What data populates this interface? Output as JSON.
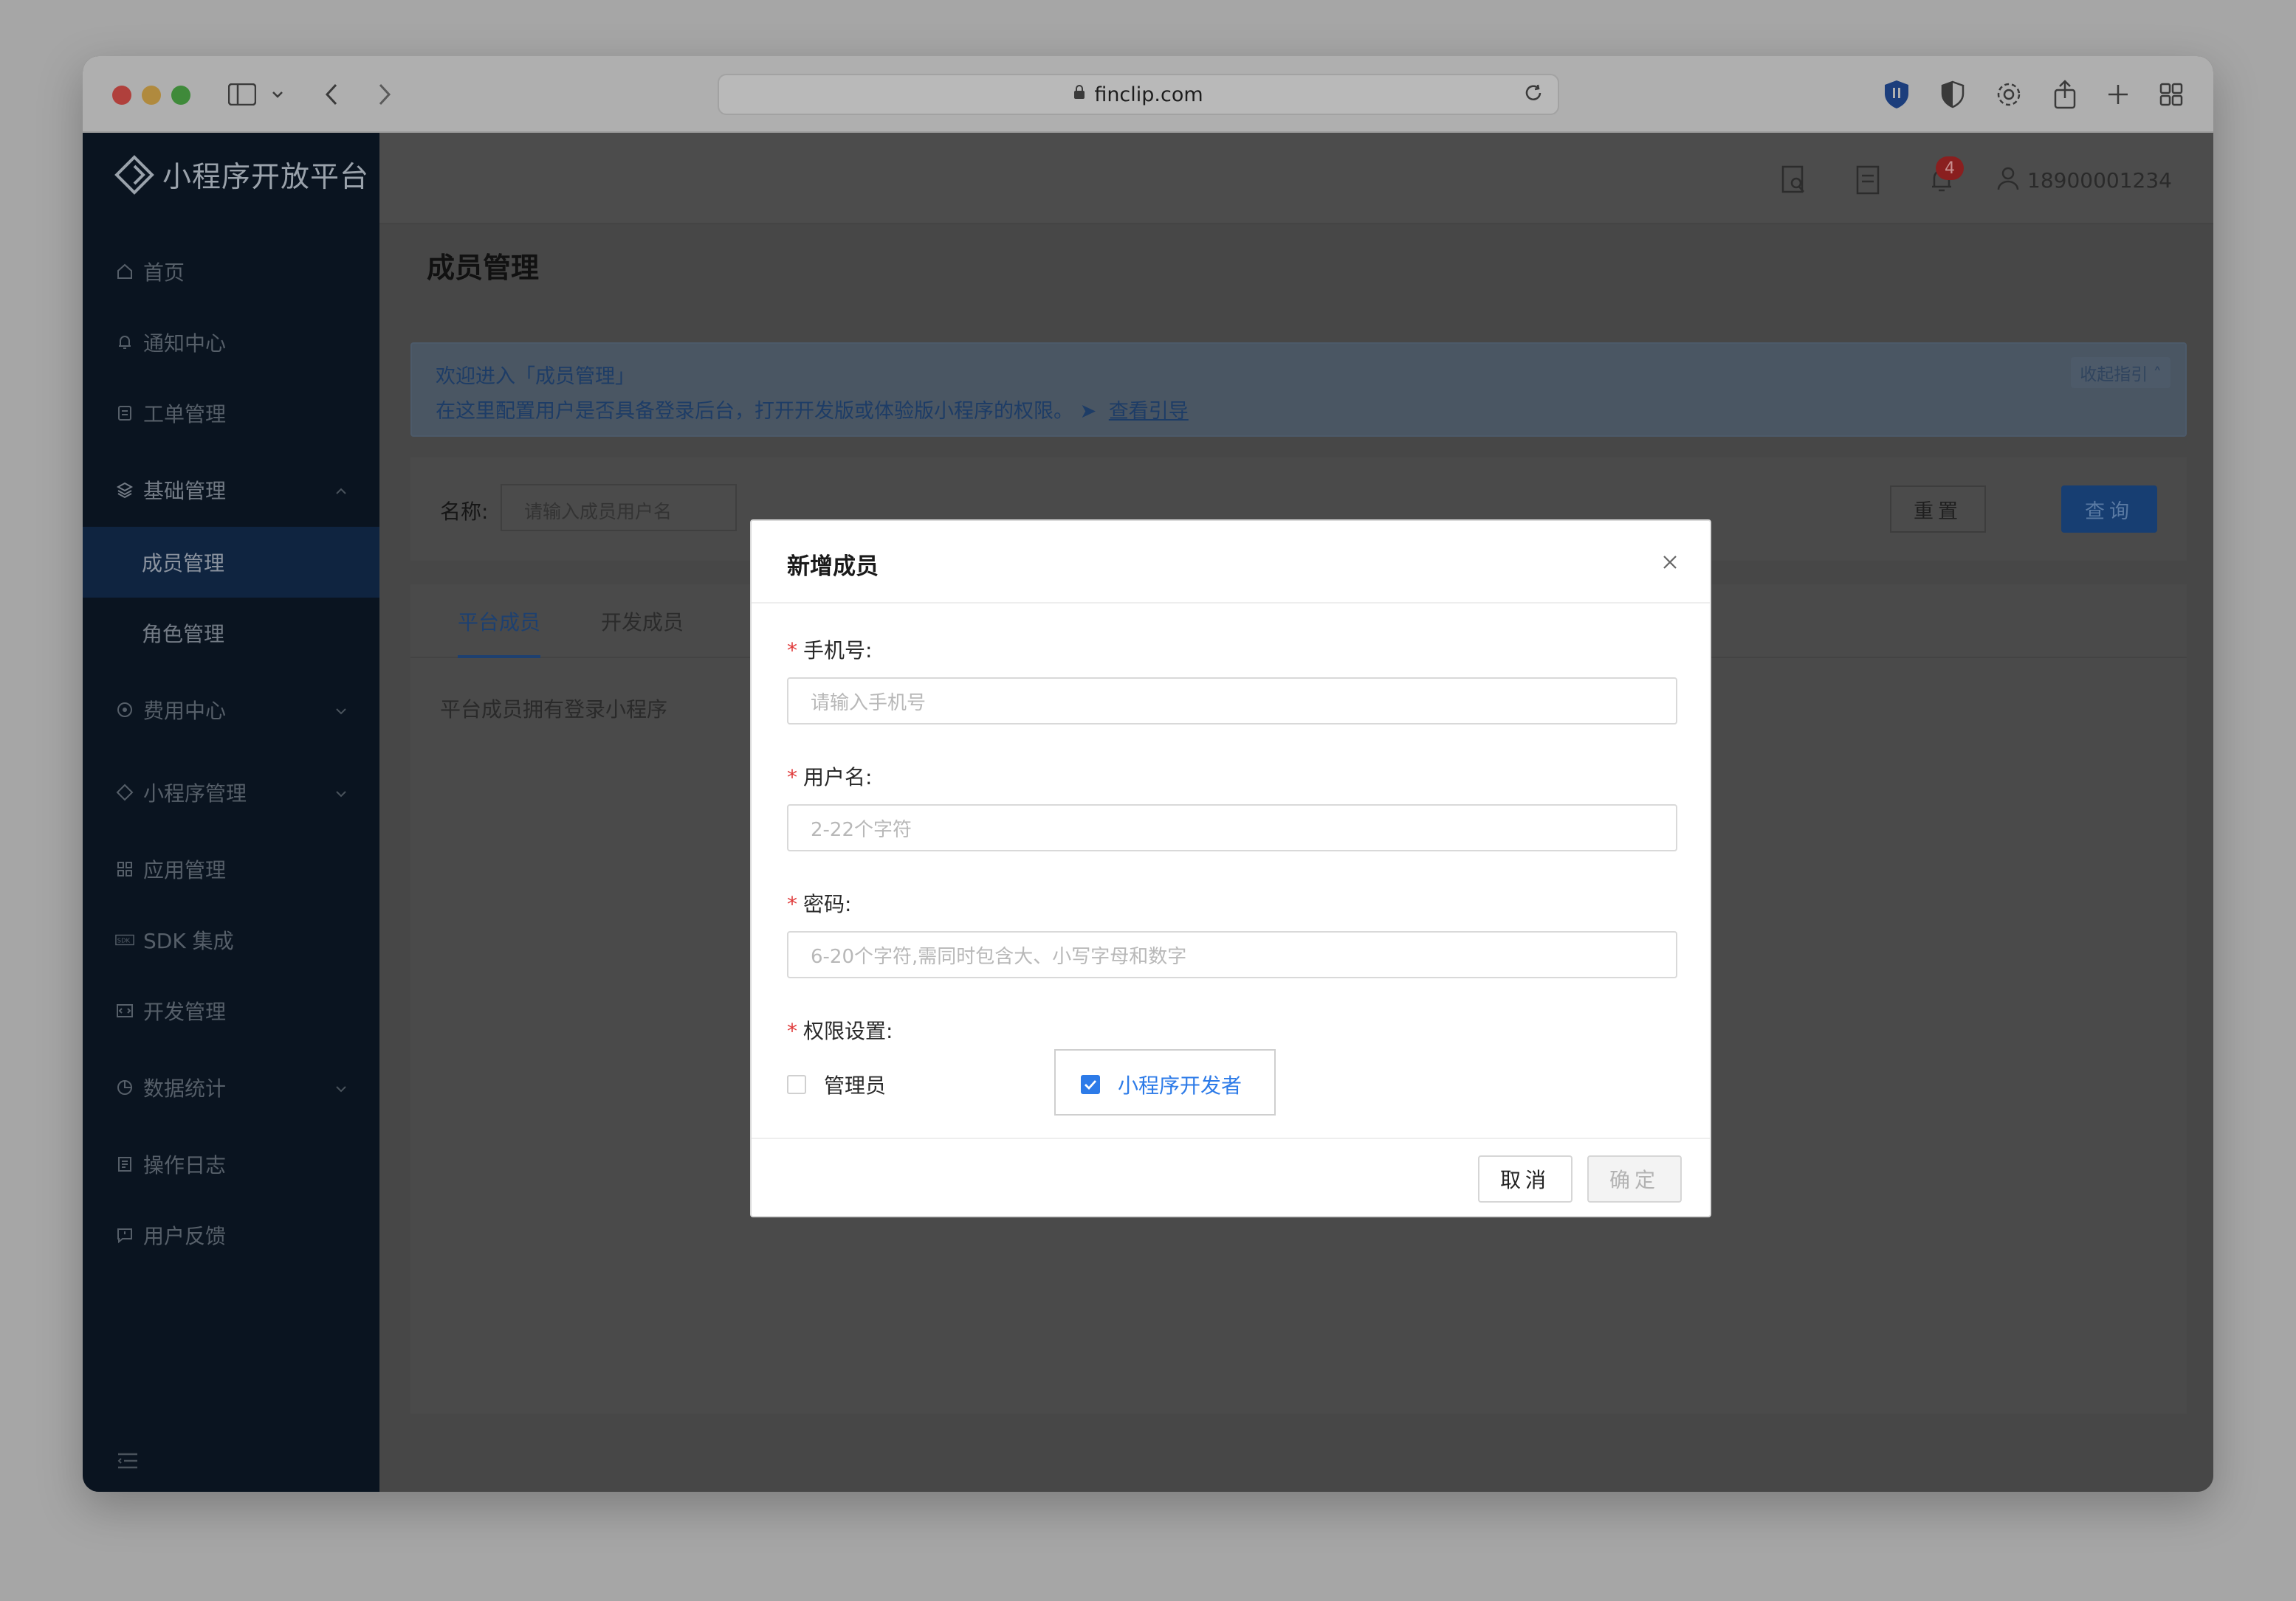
{
  "browser": {
    "url": "finclip.com"
  },
  "sidebar": {
    "logo_text": "小程序开放平台",
    "items": [
      {
        "label": "首页",
        "icon": "home-icon"
      },
      {
        "label": "通知中心",
        "icon": "bell-icon"
      },
      {
        "label": "工单管理",
        "icon": "ticket-icon"
      },
      {
        "label": "基础管理",
        "icon": "layers-icon",
        "expanded": true
      },
      {
        "label": "成员管理",
        "sub": true,
        "active": true
      },
      {
        "label": "角色管理",
        "sub": true
      },
      {
        "label": "费用中心",
        "icon": "coin-icon"
      },
      {
        "label": "小程序管理",
        "icon": "diamond-icon"
      },
      {
        "label": "应用管理",
        "icon": "grid-icon"
      },
      {
        "label": "SDK 集成",
        "icon": "sdk-icon"
      },
      {
        "label": "开发管理",
        "icon": "code-icon"
      },
      {
        "label": "数据统计",
        "icon": "pie-chart-icon"
      },
      {
        "label": "操作日志",
        "icon": "log-icon"
      },
      {
        "label": "用户反馈",
        "icon": "feedback-icon"
      }
    ]
  },
  "topbar": {
    "notification_count": "4",
    "user_phone": "18900001234"
  },
  "page": {
    "title": "成员管理",
    "guide": {
      "line1": "欢迎进入「成员管理」",
      "line2": "在这里配置用户是否具备登录后台，打开开发版或体验版小程序的权限。",
      "link": "查看引导",
      "fold": "收起指引"
    },
    "filter": {
      "name_label": "名称:",
      "name_placeholder": "请输入成员用户名",
      "reset": "重置",
      "query": "查询"
    },
    "tabs": [
      "平台成员",
      "开发成员"
    ],
    "tab_description": "平台成员拥有登录小程序"
  },
  "modal": {
    "title": "新增成员",
    "fields": {
      "phone_label": "手机号:",
      "phone_placeholder": "请输入手机号",
      "username_label": "用户名:",
      "username_placeholder": "2-22个字符",
      "password_label": "密码:",
      "password_placeholder": "6-20个字符,需同时包含大、小写字母和数字",
      "permission_label": "权限设置:"
    },
    "permissions": [
      {
        "label": "管理员",
        "checked": false
      },
      {
        "label": "小程序开发者",
        "checked": true
      }
    ],
    "cancel": "取消",
    "confirm": "确定"
  }
}
